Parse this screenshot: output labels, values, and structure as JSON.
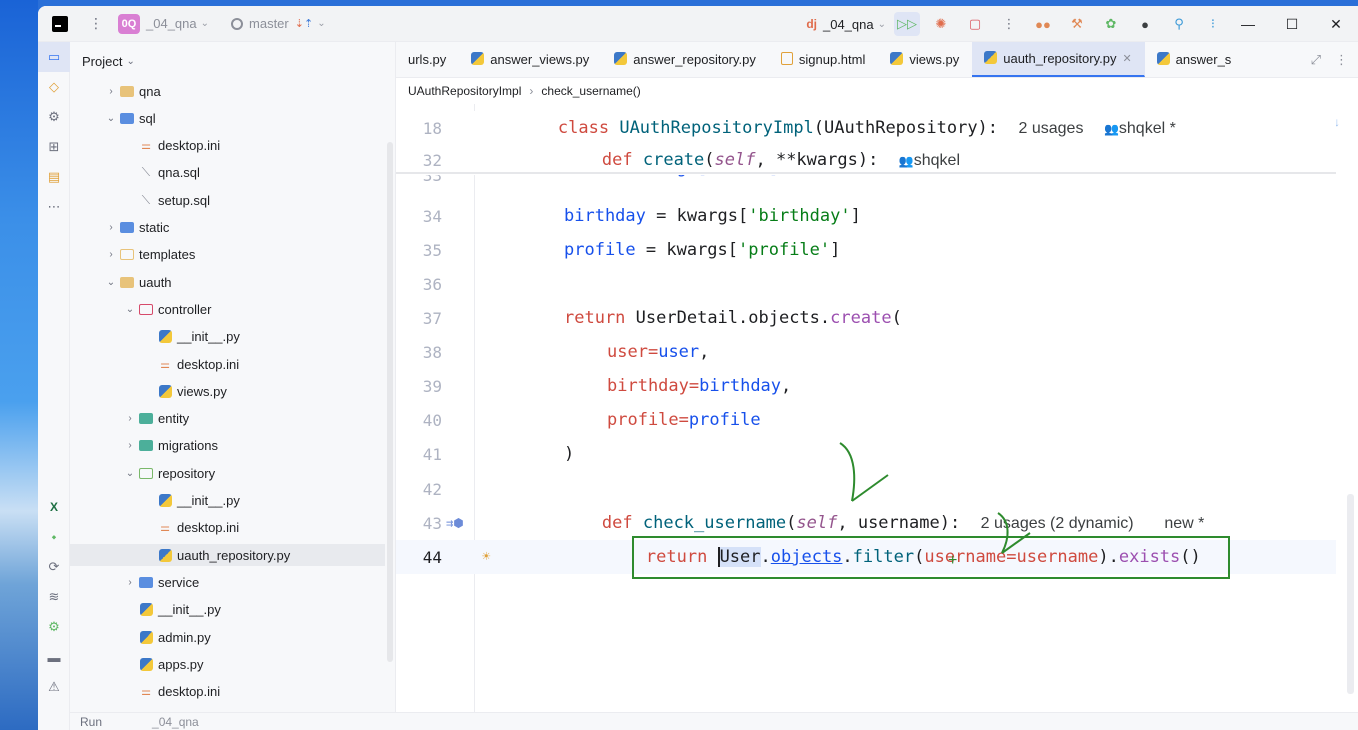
{
  "titlebar": {
    "project_badge": "0Q",
    "project_name": "_04_qna",
    "branch": "master",
    "run_config": "_04_qna",
    "run_config_prefix": "dj"
  },
  "toolstrip": {
    "icons": [
      "project-icon",
      "commit-icon",
      "pull-requests-icon",
      "structure-icon",
      "bookmarks-icon",
      "more-icon"
    ],
    "bottom_icons": [
      "excel-icon",
      "python-packages-icon",
      "services-icon",
      "layers-icon",
      "settings-icon",
      "terminal-icon",
      "problems-icon"
    ]
  },
  "project": {
    "header": "Project",
    "tree": [
      {
        "label": "qna",
        "arrow": "›",
        "kind": "folder"
      },
      {
        "label": "sql",
        "arrow": "⌄",
        "kind": "folder-blue"
      },
      {
        "label": "desktop.ini",
        "arrow": "",
        "kind": "ini"
      },
      {
        "label": "qna.sql",
        "arrow": "",
        "kind": "sql"
      },
      {
        "label": "setup.sql",
        "arrow": "",
        "kind": "sql"
      },
      {
        "label": "static",
        "arrow": "›",
        "kind": "folder-blue"
      },
      {
        "label": "templates",
        "arrow": "›",
        "kind": "folder-outline"
      },
      {
        "label": "uauth",
        "arrow": "⌄",
        "kind": "folder"
      },
      {
        "label": "controller",
        "arrow": "⌄",
        "kind": "folder-red"
      },
      {
        "label": "__init__.py",
        "arrow": "",
        "kind": "py"
      },
      {
        "label": "desktop.ini",
        "arrow": "",
        "kind": "ini"
      },
      {
        "label": "views.py",
        "arrow": "",
        "kind": "py"
      },
      {
        "label": "entity",
        "arrow": "›",
        "kind": "folder-teal"
      },
      {
        "label": "migrations",
        "arrow": "›",
        "kind": "folder-teal"
      },
      {
        "label": "repository",
        "arrow": "⌄",
        "kind": "folder-green"
      },
      {
        "label": "__init__.py",
        "arrow": "",
        "kind": "py"
      },
      {
        "label": "desktop.ini",
        "arrow": "",
        "kind": "ini"
      },
      {
        "label": "uauth_repository.py",
        "arrow": "",
        "kind": "py"
      },
      {
        "label": "service",
        "arrow": "›",
        "kind": "folder-blue"
      },
      {
        "label": "__init__.py",
        "arrow": "",
        "kind": "py"
      },
      {
        "label": "admin.py",
        "arrow": "",
        "kind": "py"
      },
      {
        "label": "apps.py",
        "arrow": "",
        "kind": "py"
      },
      {
        "label": "desktop.ini",
        "arrow": "",
        "kind": "ini"
      }
    ]
  },
  "tabs": [
    {
      "label": "urls.py",
      "icon": "none"
    },
    {
      "label": "answer_views.py",
      "icon": "py"
    },
    {
      "label": "answer_repository.py",
      "icon": "py"
    },
    {
      "label": "signup.html",
      "icon": "html"
    },
    {
      "label": "views.py",
      "icon": "py"
    },
    {
      "label": "uauth_repository.py",
      "icon": "py",
      "active": true
    },
    {
      "label": "answer_s",
      "icon": "py"
    }
  ],
  "breadcrumb": {
    "class": "UAuthRepositoryImpl",
    "method": "check_username()"
  },
  "editor": {
    "warnings": "1",
    "line_numbers": {
      "l18": "18",
      "l32": "32",
      "l33": "33",
      "l34": "34",
      "l35": "35",
      "l36": "36",
      "l37": "37",
      "l38": "38",
      "l39": "39",
      "l40": "40",
      "l41": "41",
      "l42": "42",
      "l43": "43",
      "l44": "44"
    },
    "l18": {
      "kw": "class",
      "name": "UAuthRepositoryImpl",
      "base": "(UAuthRepository):",
      "hint": "2 usages",
      "author": "shqkel *"
    },
    "l32": {
      "kw": "def",
      "name": "create",
      "self": "self",
      "rest": ", **kwargs):",
      "author": "shqkel"
    },
    "l33": {
      "text": "user = kwargs['user']"
    },
    "l34": {
      "var": "birthday",
      "eq": " = kwargs[",
      "key": "'birthday'",
      "end": "]"
    },
    "l35": {
      "var": "profile",
      "eq": " = kwargs[",
      "key": "'profile'",
      "end": "]"
    },
    "l37": {
      "kw": "return",
      "obj": "UserDetail.objects.",
      "meth": "create",
      "end": "("
    },
    "l38": {
      "name": "user",
      "eq": "=",
      "val": "user",
      "end": ","
    },
    "l39": {
      "name": "birthday",
      "eq": "=",
      "val": "birthday",
      "end": ","
    },
    "l40": {
      "name": "profile",
      "eq": "=",
      "val": "profile"
    },
    "l41": {
      "text": ")"
    },
    "l43": {
      "kw": "def",
      "name": "check_username",
      "self": "self",
      "rest": ", username):",
      "hint": "2 usages (2 dynamic)",
      "hint2": "new *"
    },
    "l44": {
      "kw": "return",
      "user": "User",
      "dot1": ".",
      "objects": "objects",
      "dot2": ".",
      "filter": "filter",
      "open": "(",
      "named": "username",
      "eq": "=",
      "val": "username",
      "close": ").",
      "exists": "exists",
      "end": "()"
    }
  },
  "bottom": {
    "label": "Run",
    "config": "_04_qna"
  },
  "colors": {
    "accent": "#3574f0",
    "annotation": "#2e8b2e"
  }
}
